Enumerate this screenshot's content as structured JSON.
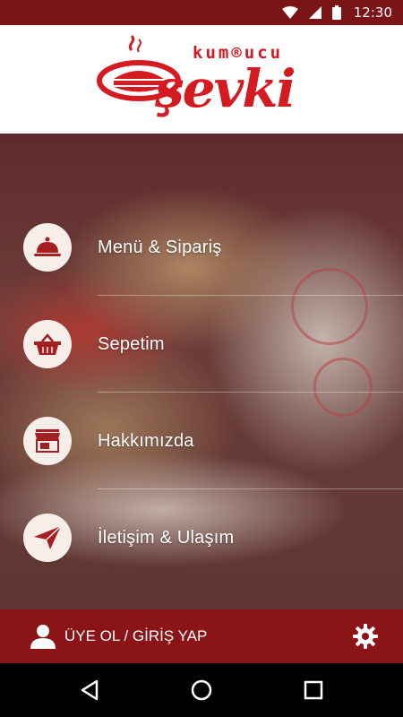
{
  "status_bar": {
    "time": "12:30",
    "icons": [
      "wifi-icon",
      "signal-icon",
      "battery-icon"
    ]
  },
  "header": {
    "logo_top": "kum®ucu",
    "logo_main": "şevki"
  },
  "menu": {
    "items": [
      {
        "label": "Menü & Sipariş",
        "icon": "food-cloche-icon"
      },
      {
        "label": "Sepetim",
        "icon": "basket-icon"
      },
      {
        "label": "Hakkımızda",
        "icon": "storefront-icon"
      },
      {
        "label": "İletişim & Ulaşım",
        "icon": "paper-plane-icon"
      }
    ]
  },
  "footer": {
    "login_label": "ÜYE OL / GİRİŞ YAP",
    "user_icon": "user-icon",
    "settings_icon": "gear-icon"
  },
  "nav_bar": {
    "icons": [
      "back-icon",
      "home-icon",
      "recents-icon"
    ]
  },
  "colors": {
    "brand_red": "#d51b22",
    "footer_red": "#8b1417",
    "status_red": "#7a1416",
    "icon_circle": "#f7eeea",
    "icon_color": "#a31f22"
  }
}
